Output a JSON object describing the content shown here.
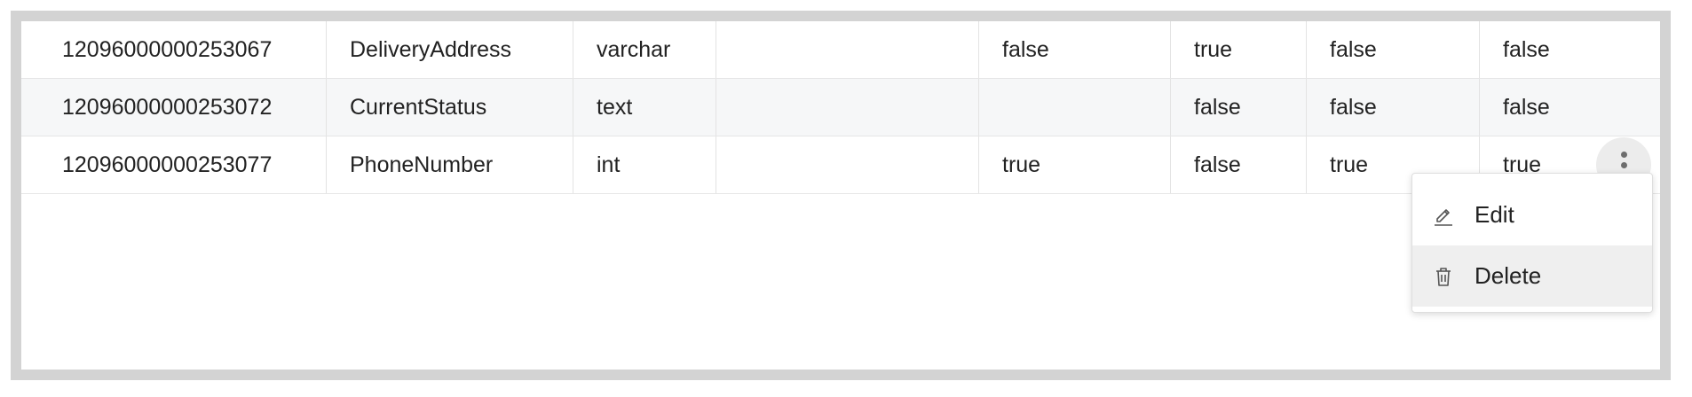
{
  "table": {
    "rows": [
      {
        "id": "12096000000253067",
        "name": "DeliveryAddress",
        "type": "varchar",
        "col4": "",
        "col5": "false",
        "col6": "true",
        "col7": "false",
        "col8": "false"
      },
      {
        "id": "12096000000253072",
        "name": "CurrentStatus",
        "type": "text",
        "col4": "",
        "col5": "",
        "col6": "false",
        "col7": "false",
        "col8": "false"
      },
      {
        "id": "12096000000253077",
        "name": "PhoneNumber",
        "type": "int",
        "col4": "",
        "col5": "true",
        "col6": "false",
        "col7": "true",
        "col8": "true"
      }
    ]
  },
  "menu": {
    "items": [
      {
        "label": "Edit",
        "icon": "edit-icon"
      },
      {
        "label": "Delete",
        "icon": "trash-icon"
      }
    ]
  },
  "colors": {
    "frame": "#d3d3d3",
    "row_alt": "#f6f7f8",
    "hover": "#efefef"
  }
}
